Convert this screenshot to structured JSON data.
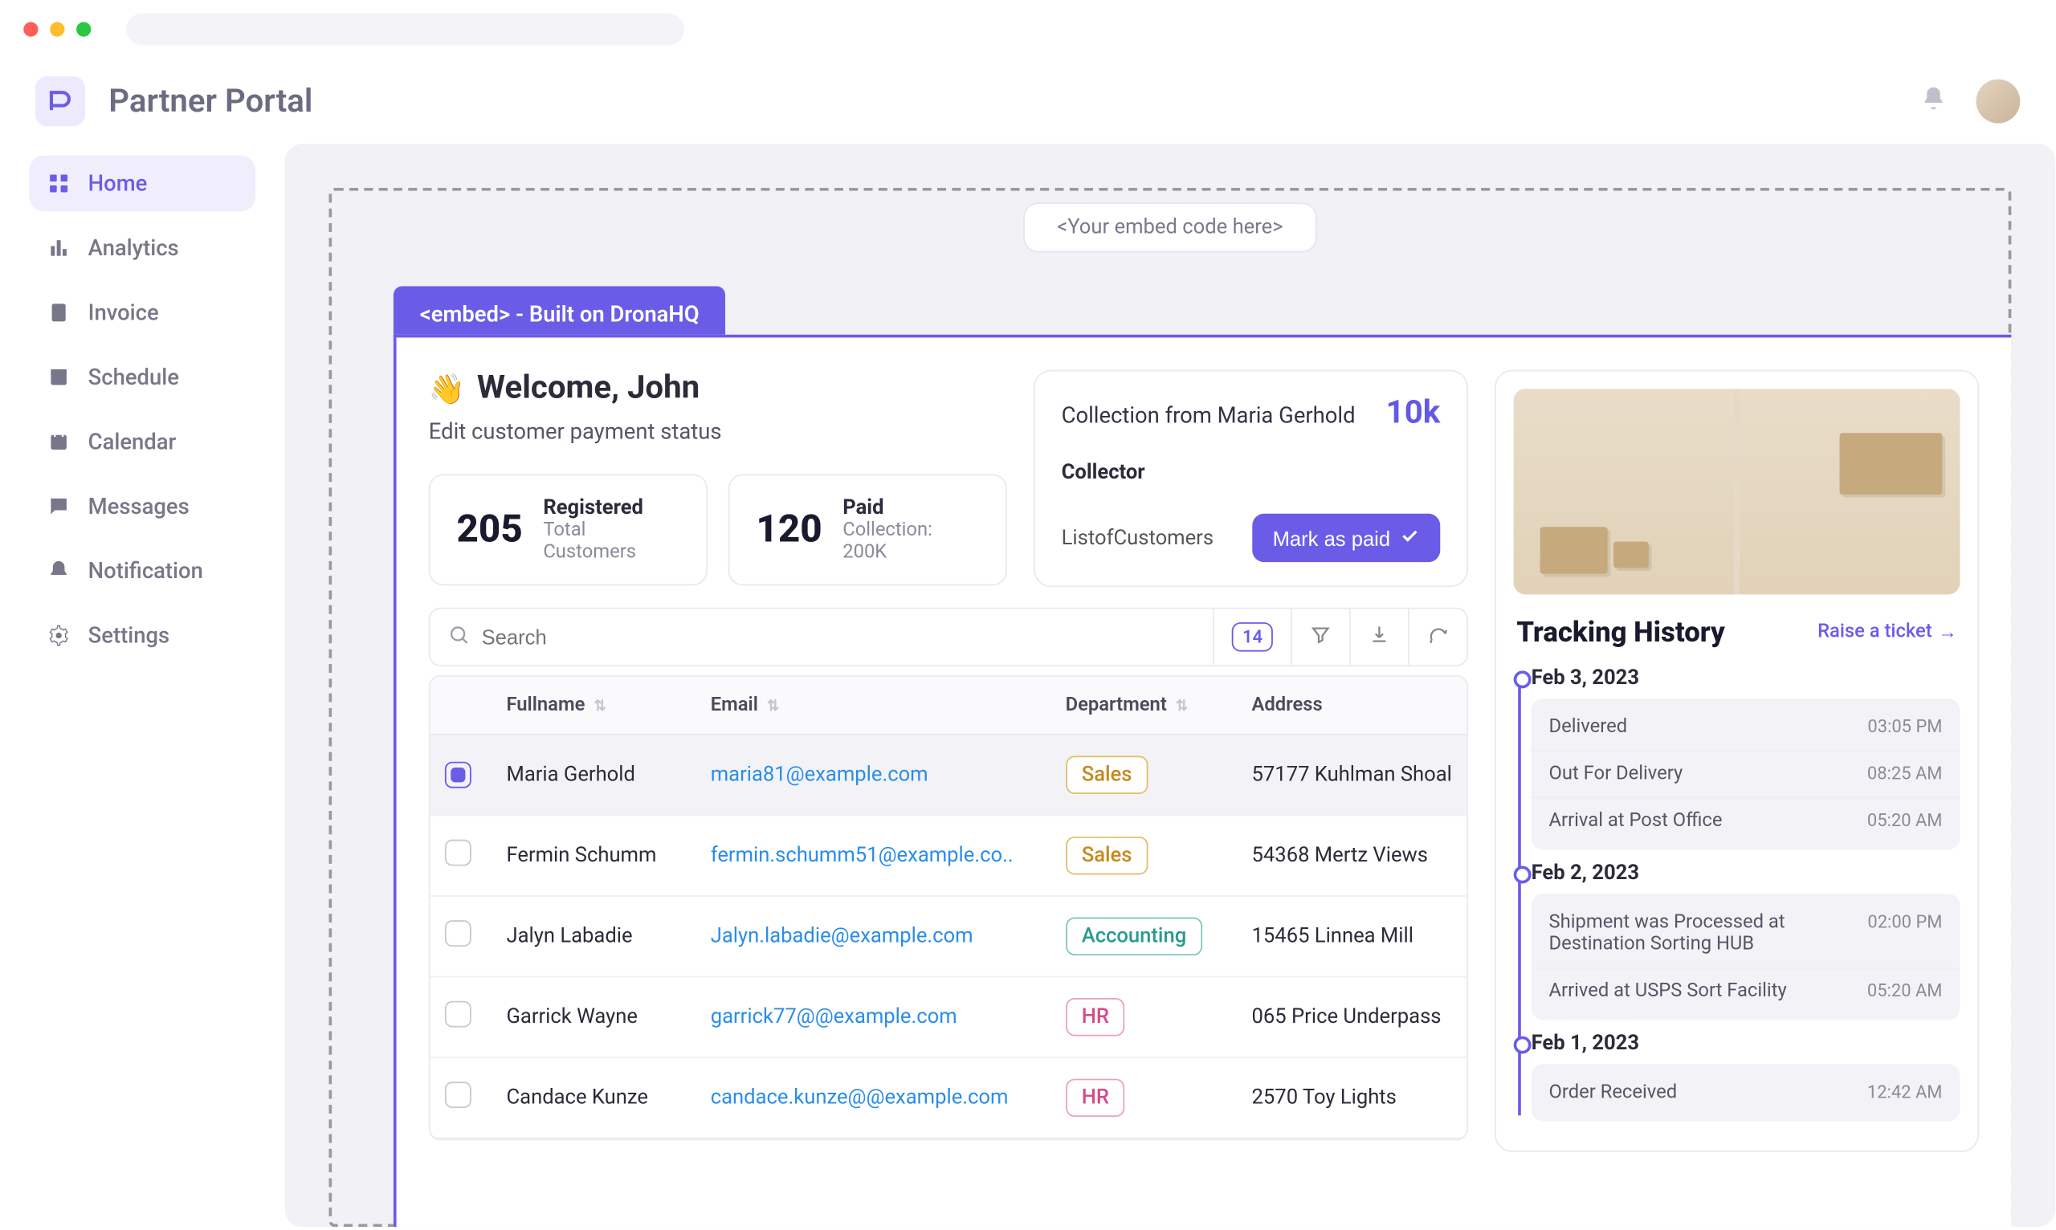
{
  "brand": "Partner Portal",
  "embed_hint": "<Your embed code here>",
  "embed_tab": "<embed> - Built on DronaHQ",
  "sidebar": {
    "items": [
      {
        "label": "Home",
        "icon": "grid-icon",
        "active": true
      },
      {
        "label": "Analytics",
        "icon": "chart-icon"
      },
      {
        "label": "Invoice",
        "icon": "invoice-icon"
      },
      {
        "label": "Schedule",
        "icon": "schedule-icon"
      },
      {
        "label": "Calendar",
        "icon": "calendar-icon"
      },
      {
        "label": "Messages",
        "icon": "message-icon"
      },
      {
        "label": "Notification",
        "icon": "bell-icon"
      },
      {
        "label": "Settings",
        "icon": "gear-icon"
      }
    ]
  },
  "welcome": {
    "title": "Welcome, John",
    "subtitle": "Edit customer payment status"
  },
  "stats": [
    {
      "value": "205",
      "title": "Registered",
      "sub": "Total Customers"
    },
    {
      "value": "120",
      "title": "Paid",
      "sub": "Collection: 200K"
    }
  ],
  "collection": {
    "text": "Collection from Maria Gerhold",
    "amount": "10k",
    "collector_label": "Collector",
    "list_label": "ListofCustomers",
    "button": "Mark as paid"
  },
  "table": {
    "search_placeholder": "Search",
    "count": "14",
    "columns": [
      "Fullname",
      "Email",
      "Department",
      "Address"
    ],
    "rows": [
      {
        "selected": true,
        "name": "Maria Gerhold",
        "email": "maria81@example.com",
        "dept": "Sales",
        "address": "57177 Kuhlman Shoal"
      },
      {
        "selected": false,
        "name": "Fermin Schumm",
        "email": "fermin.schumm51@example.co..",
        "dept": "Sales",
        "address": "54368 Mertz Views"
      },
      {
        "selected": false,
        "name": "Jalyn Labadie",
        "email": "Jalyn.labadie@example.com",
        "dept": "Accounting",
        "address": "15465 Linnea Mill"
      },
      {
        "selected": false,
        "name": "Garrick Wayne",
        "email": "garrick77@@example.com",
        "dept": "HR",
        "address": "065 Price Underpass"
      },
      {
        "selected": false,
        "name": "Candace Kunze",
        "email": "candace.kunze@@example.com",
        "dept": "HR",
        "address": "2570 Toy Lights"
      }
    ]
  },
  "tracking": {
    "title": "Tracking History",
    "ticket_link": "Raise a ticket",
    "groups": [
      {
        "date": "Feb 3, 2023",
        "events": [
          {
            "text": "Delivered",
            "time": "03:05 PM"
          },
          {
            "text": "Out For Delivery",
            "time": "08:25 AM"
          },
          {
            "text": "Arrival at Post Office",
            "time": "05:20 AM"
          }
        ]
      },
      {
        "date": "Feb 2, 2023",
        "events": [
          {
            "text": "Shipment was Processed at Destination Sorting HUB",
            "time": "02:00 PM"
          },
          {
            "text": "Arrived at USPS Sort Facility",
            "time": "05:20 AM"
          }
        ]
      },
      {
        "date": "Feb 1, 2023",
        "events": [
          {
            "text": "Order Received",
            "time": "12:42 AM"
          }
        ]
      }
    ]
  }
}
